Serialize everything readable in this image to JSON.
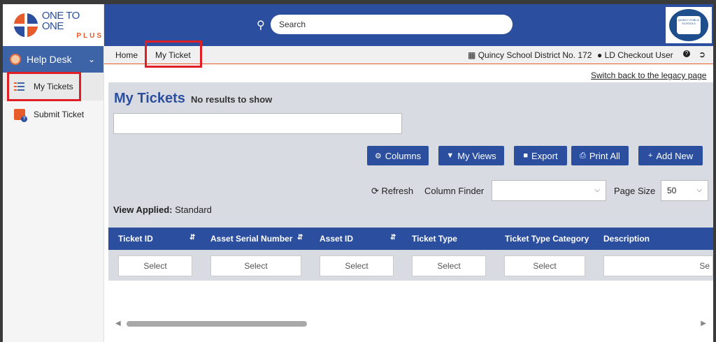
{
  "logo": {
    "line1": "ONE TO ONE",
    "line2": "PLUS"
  },
  "sidebar": {
    "section_label": "Help Desk",
    "items": [
      {
        "label": "My Tickets",
        "icon": "checklist-icon",
        "active": true
      },
      {
        "label": "Submit Ticket",
        "icon": "ticket-help-icon",
        "active": false
      }
    ]
  },
  "header": {
    "search_placeholder": "Search",
    "school_logo_text": "QUINCY PUBLIC SCHOOLS"
  },
  "topnav": {
    "home": "Home",
    "my_ticket": "My Ticket",
    "district": "Quincy School District No. 172",
    "user": "LD Checkout User"
  },
  "legacy_link": "Switch back to the legacy page",
  "main": {
    "title": "My Tickets",
    "status": "No results to show",
    "buttons": {
      "columns": "Columns",
      "my_views": "My Views",
      "export": "Export",
      "print_all": "Print All",
      "add_new": "Add New"
    },
    "refresh": "Refresh",
    "column_finder": "Column Finder",
    "page_size_label": "Page Size",
    "page_size_value": "50",
    "view_applied_label": "View Applied:",
    "view_applied_value": "Standard"
  },
  "table": {
    "columns": [
      "Ticket ID",
      "Asset Serial Number",
      "Asset ID",
      "Ticket Type",
      "Ticket Type Category",
      "Description"
    ],
    "filter_placeholder": "Select",
    "filter_partial": "Se"
  },
  "colors": {
    "primary": "#2b4f9e",
    "accent": "#e85b2b",
    "highlight": "#e01e25"
  }
}
